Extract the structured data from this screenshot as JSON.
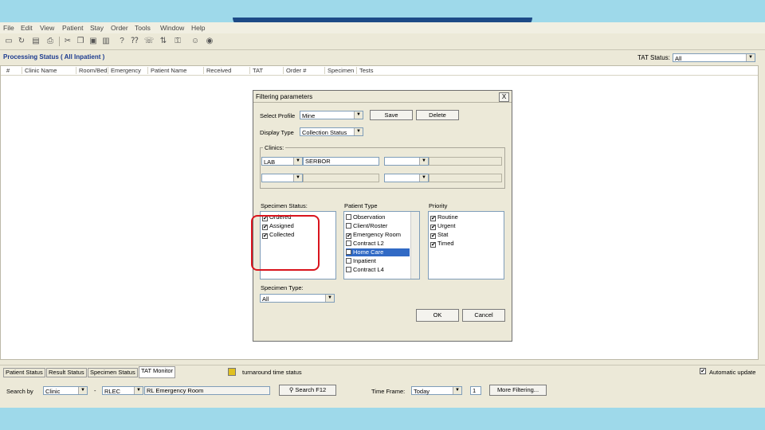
{
  "menu": [
    "File",
    "Edit",
    "View",
    "Patient",
    "Stay",
    "Order",
    "Tools",
    "Window",
    "Help"
  ],
  "header": {
    "processing_title": "Processing Status ( All Inpatient )",
    "tat_status_label": "TAT Status:",
    "tat_status_value": "All"
  },
  "grid": {
    "columns": [
      "#",
      "Clinic Name",
      "Room/Bed",
      "Emergency",
      "Patient Name",
      "Received",
      "TAT",
      "Order #",
      "Specimen",
      "Tests"
    ]
  },
  "dialog": {
    "title": "Filtering parameters",
    "close": "X",
    "select_profile_label": "Select Profile",
    "select_profile_value": "Mine",
    "save": "Save",
    "delete": "Delete",
    "display_type_label": "Display Type",
    "display_type_value": "Collection Status",
    "clinics_label": "Clinics:",
    "clinic_code": "LAB",
    "clinic_name": "SERBOR",
    "specimen_status_label": "Specimen Status:",
    "specimen_status": [
      {
        "label": "Ordered",
        "mark": "✔"
      },
      {
        "label": "Assigned",
        "mark": "✔"
      },
      {
        "label": "Collected",
        "mark": "✔"
      }
    ],
    "patient_type_label": "Patient Type",
    "patient_type": [
      {
        "label": "Observation",
        "mark": ""
      },
      {
        "label": "Client/Roster",
        "mark": ""
      },
      {
        "label": "Emergency Room",
        "mark": "✔"
      },
      {
        "label": "Contract L2",
        "mark": ""
      },
      {
        "label": "Home Care",
        "mark": ""
      },
      {
        "label": "Inpatient",
        "mark": ""
      },
      {
        "label": "Contract L4",
        "mark": ""
      }
    ],
    "priority_label": "Priority",
    "priority": [
      {
        "label": "Routine",
        "mark": "✔"
      },
      {
        "label": "Urgent",
        "mark": "✔"
      },
      {
        "label": "Stat",
        "mark": "✔"
      },
      {
        "label": "Timed",
        "mark": "✔"
      }
    ],
    "specimen_type_label": "Specimen Type:",
    "specimen_type_value": "All",
    "ok": "OK",
    "cancel": "Cancel"
  },
  "tabs": [
    "Patient Status",
    "Result Status",
    "Specimen Status",
    "TAT Monitor"
  ],
  "status_text": "turnaround time status",
  "auto_update": "Automatic update",
  "bottom": {
    "search_by_label": "Search by",
    "search_by_value": "Clinic",
    "dash": "-",
    "clinic_code": "RLEC",
    "clinic_desc": "RL Emergency Room",
    "search_button": "Search F12",
    "time_frame_label": "Time Frame:",
    "time_frame_value": "Today",
    "time_num": "1",
    "more_filtering": "More Filtering..."
  },
  "colors": {
    "accent": "#1d4a86",
    "highlight": "#d9141d",
    "band": "#9ed9ea"
  }
}
